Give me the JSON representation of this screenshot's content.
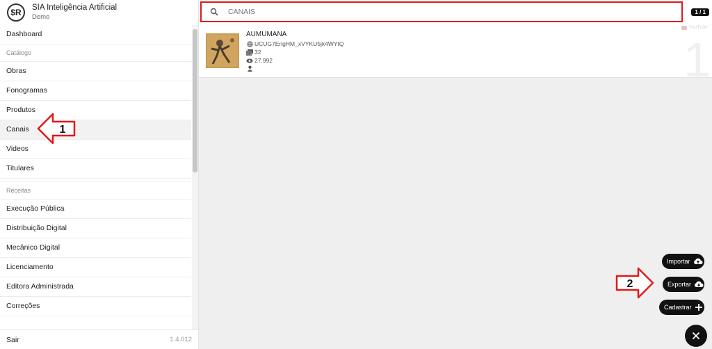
{
  "brand": {
    "logo": "$R",
    "title": "SIA Inteligência Artificial",
    "subtitle": "Demo"
  },
  "menu": {
    "dashboard": "Dashboard",
    "section_catalogo": "Catálogo",
    "obras": "Obras",
    "fonogramas": "Fonogramas",
    "produtos": "Produtos",
    "canais": "Canais",
    "videos": "Videos",
    "titulares": "Titulares",
    "section_receitas": "Receitas",
    "execucao_publica": "Execução Pública",
    "distribuicao_digital": "Distribuição Digital",
    "mecanico_digital": "Mecânico Digital",
    "licenciamento": "Licenciamento",
    "editora_administrada": "Editora Administrada",
    "correcoes": "Correções"
  },
  "footer": {
    "logout": "Sair",
    "version": "1.4.012"
  },
  "search": {
    "placeholder": "CANAIS",
    "pager": "1 / 1"
  },
  "channel": {
    "name": "AUMUMANA",
    "id": "UCUG7EngHM_xVYKU5jk4WYtQ",
    "videos": "32",
    "views": "27.992",
    "owner": "",
    "platform": "YouTube",
    "index": "1"
  },
  "actions": {
    "importar": "Importar",
    "exportar": "Exportar",
    "cadastrar": "Cadastrar"
  },
  "annotations": {
    "one": "1",
    "two": "2"
  },
  "colors": {
    "highlight": "#e0191c",
    "fab": "#111111"
  }
}
